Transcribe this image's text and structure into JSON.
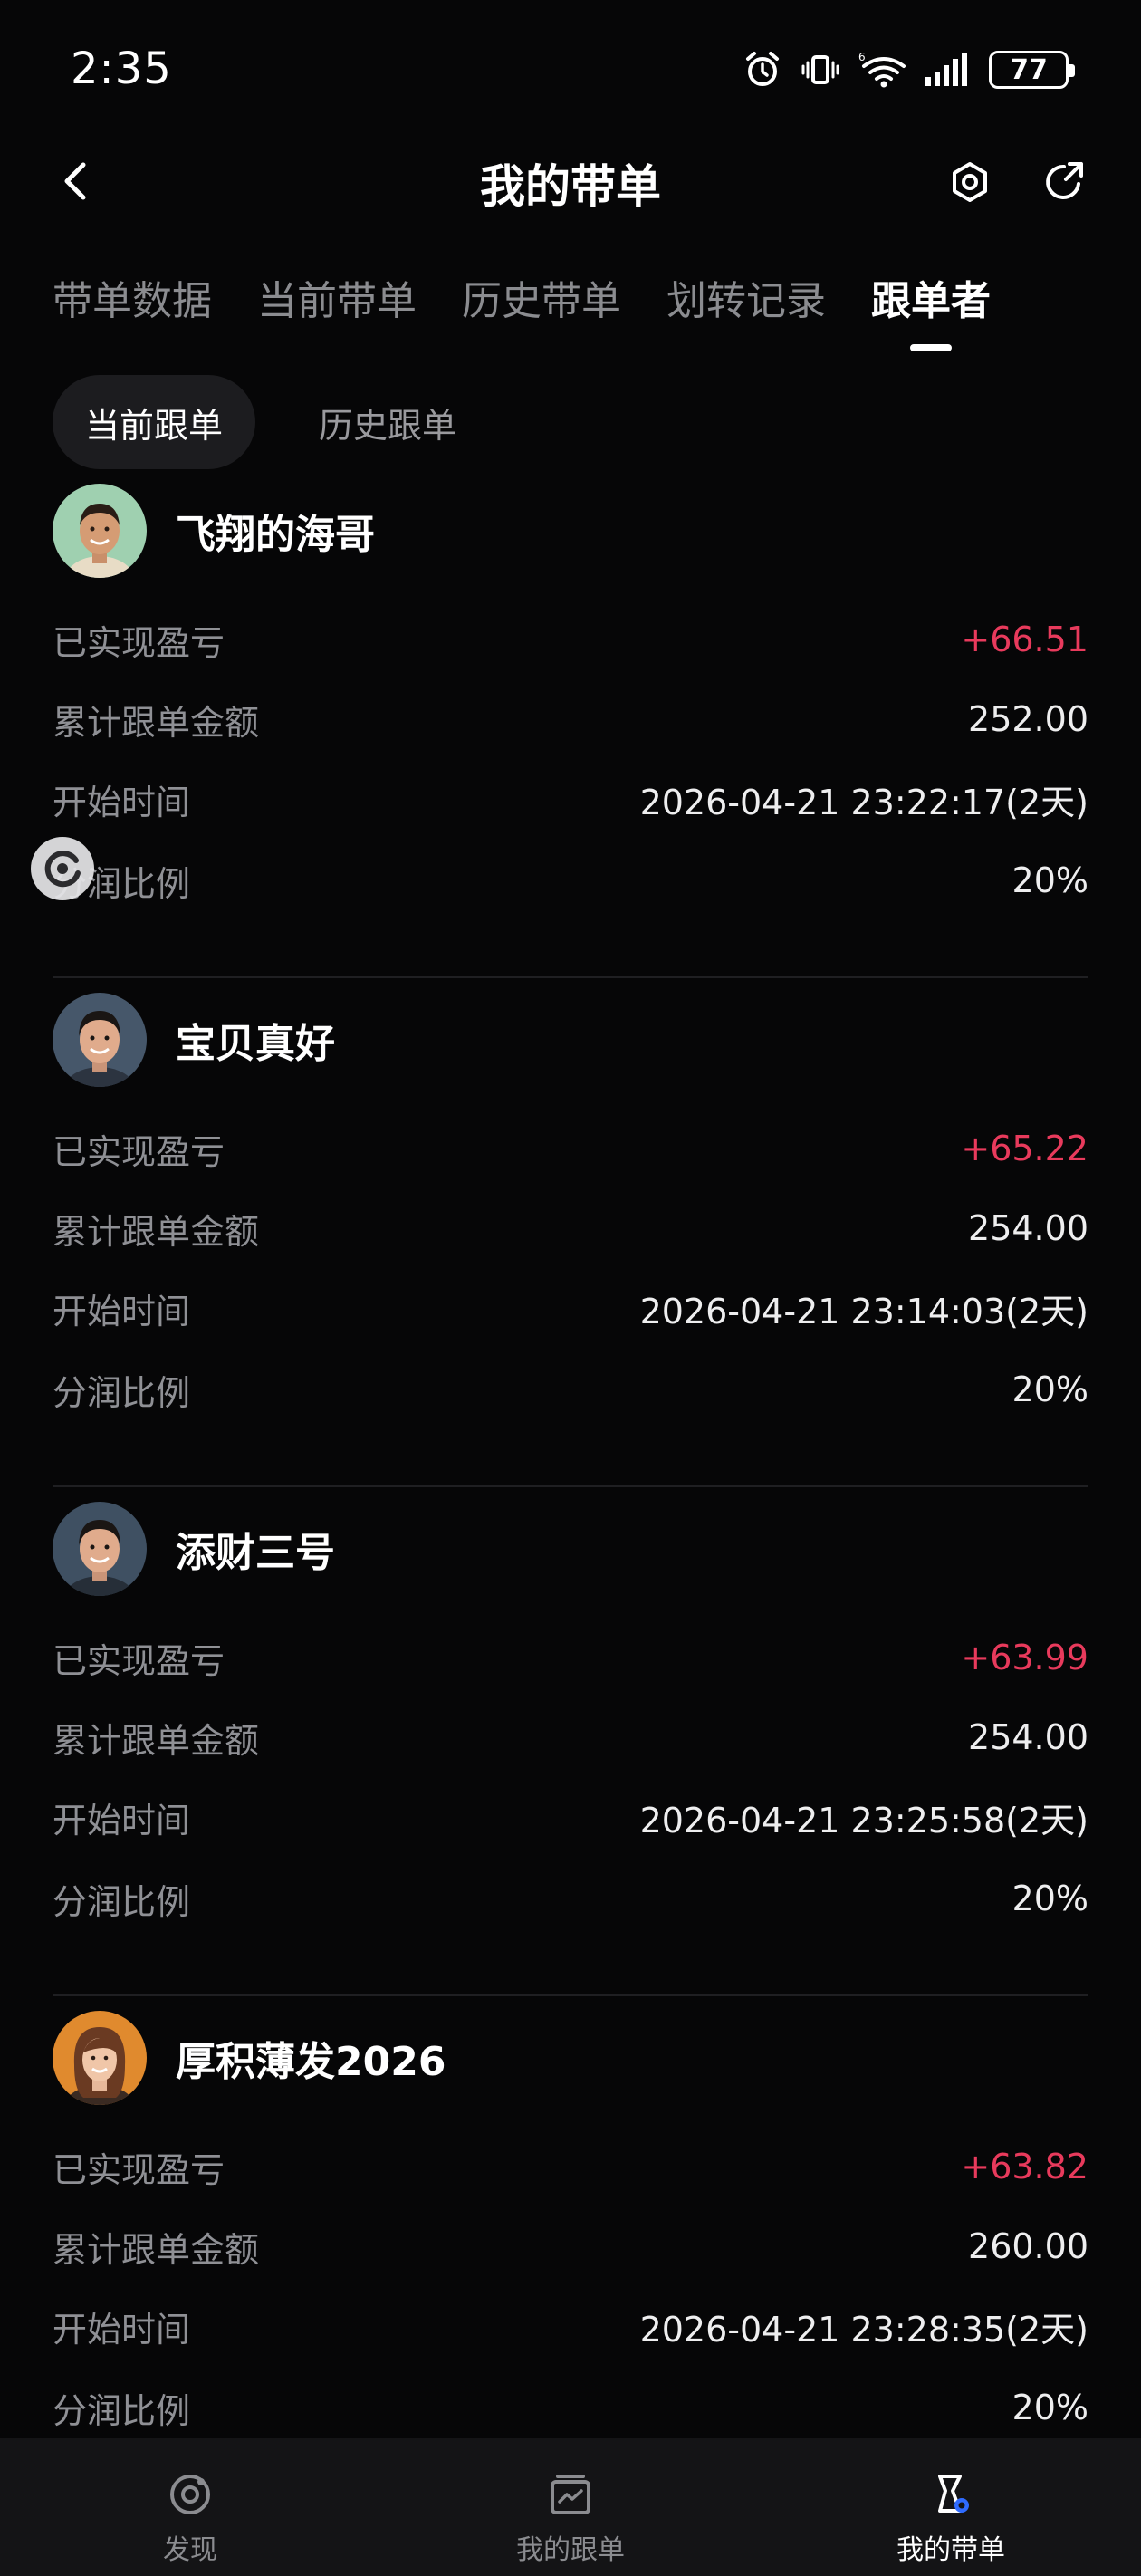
{
  "status_bar": {
    "time": "2:35",
    "battery": "77"
  },
  "header": {
    "title": "我的带单"
  },
  "tabs": [
    {
      "label": "带单数据"
    },
    {
      "label": "当前带单"
    },
    {
      "label": "历史带单"
    },
    {
      "label": "划转记录"
    },
    {
      "label": "跟单者"
    }
  ],
  "subtabs": [
    {
      "label": "当前跟单"
    },
    {
      "label": "历史跟单"
    }
  ],
  "followers": [
    {
      "name": "飞翔的海哥",
      "realized_pnl_label": "已实现盈亏",
      "realized_pnl": "+66.51",
      "total_amount_label": "累计跟单金额",
      "total_amount": "252.00",
      "start_time_label": "开始时间",
      "start_time": "2026-04-21 23:22:17(2天)",
      "share_ratio_label": "分润比例",
      "share_ratio": "20%"
    },
    {
      "name": "宝贝真好",
      "realized_pnl_label": "已实现盈亏",
      "realized_pnl": "+65.22",
      "total_amount_label": "累计跟单金额",
      "total_amount": "254.00",
      "start_time_label": "开始时间",
      "start_time": "2026-04-21 23:14:03(2天)",
      "share_ratio_label": "分润比例",
      "share_ratio": "20%"
    },
    {
      "name": "添财三号",
      "realized_pnl_label": "已实现盈亏",
      "realized_pnl": "+63.99",
      "total_amount_label": "累计跟单金额",
      "total_amount": "254.00",
      "start_time_label": "开始时间",
      "start_time": "2026-04-21 23:25:58(2天)",
      "share_ratio_label": "分润比例",
      "share_ratio": "20%"
    },
    {
      "name": "厚积薄发2026",
      "realized_pnl_label": "已实现盈亏",
      "realized_pnl": "+63.82",
      "total_amount_label": "累计跟单金额",
      "total_amount": "260.00",
      "start_time_label": "开始时间",
      "start_time": "2026-04-21 23:28:35(2天)",
      "share_ratio_label": "分润比例",
      "share_ratio": "20%"
    }
  ],
  "bottom_nav": [
    {
      "label": "发现",
      "icon": "discover-icon"
    },
    {
      "label": "我的跟单",
      "icon": "copy-trade-icon"
    },
    {
      "label": "我的带单",
      "icon": "lead-trade-icon"
    }
  ],
  "colors": {
    "profit": "#e83a5c",
    "background": "#060607",
    "accent": "#2f6bff"
  }
}
